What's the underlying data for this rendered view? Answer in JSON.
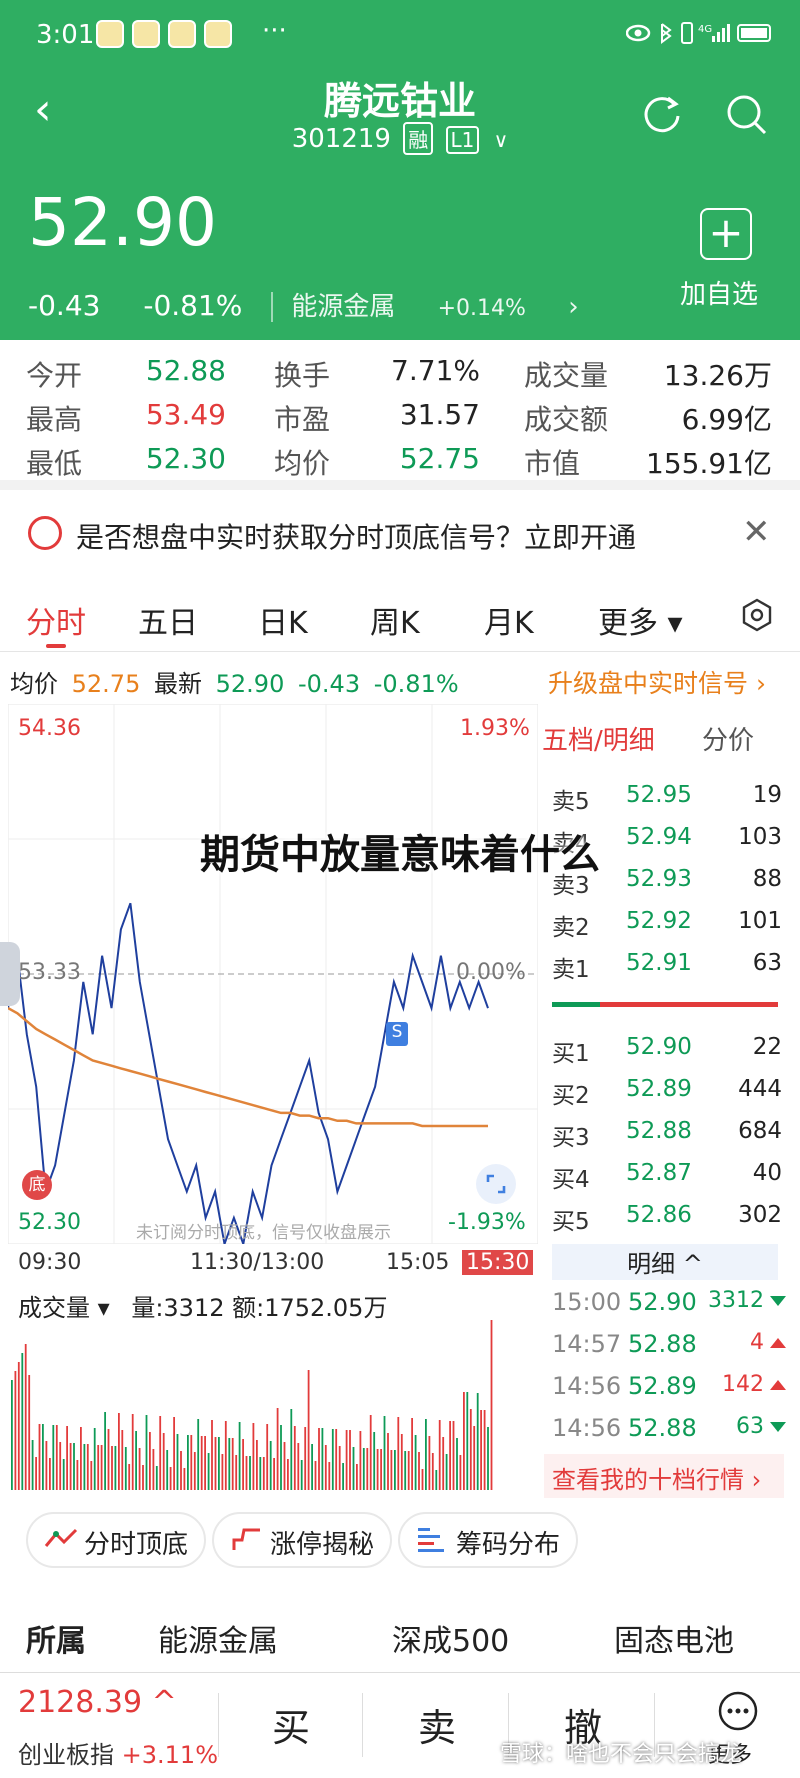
{
  "status": {
    "time": "3:01",
    "dots": "···",
    "right": "4G"
  },
  "header": {
    "name": "腾远钴业",
    "code": "301219",
    "tag1": "融",
    "tag2": "L1",
    "chevron": "∨",
    "back": "‹",
    "price": "52.90",
    "change": "-0.43",
    "change_pct": "-0.81%",
    "sector": "能源金属",
    "sector_pct": "+0.14%",
    "sector_arrow": "›",
    "add_icon": "+",
    "add_label": "加自选"
  },
  "stats": [
    {
      "label": "今开",
      "value": "52.88",
      "color": "green"
    },
    {
      "label": "换手",
      "value": "7.71%",
      "color": "black"
    },
    {
      "label": "成交量",
      "value": "13.26万",
      "color": "black"
    },
    {
      "label": "最高",
      "value": "53.49",
      "color": "red"
    },
    {
      "label": "市盈",
      "value": "31.57",
      "color": "black"
    },
    {
      "label": "成交额",
      "value": "6.99亿",
      "color": "black"
    },
    {
      "label": "最低",
      "value": "52.30",
      "color": "green"
    },
    {
      "label": "均价",
      "value": "52.75",
      "color": "green"
    },
    {
      "label": "市值",
      "value": "155.91亿",
      "color": "black"
    }
  ],
  "banner": {
    "text": "是否想盘中实时获取分时顶底信号？立即开通",
    "close": "✕"
  },
  "tabs": [
    "分时",
    "五日",
    "日K",
    "周K",
    "月K",
    "更多 ▾"
  ],
  "info": {
    "avg_label": "均价",
    "avg": "52.75",
    "last_label": "最新",
    "last": "52.90",
    "chg": "-0.43",
    "pct": "-0.81%",
    "upgrade": "升级盘中实时信号 ›"
  },
  "chart": {
    "high": "54.36",
    "high_pct": "1.93%",
    "mid": "53.33",
    "mid_pct": "0.00%",
    "low": "52.30",
    "low_pct": "-1.93%",
    "note": "未订阅分时顶底，信号仅收盘展示",
    "s_mark": "S",
    "bottom_mark": "底",
    "times": [
      "09:30",
      "11:30/13:00",
      "15:05",
      "15:30"
    ]
  },
  "chart_data": {
    "type": "line",
    "ylim": [
      52.3,
      54.36
    ],
    "series": [
      {
        "values": [
          53.2,
          53.4,
          53.1,
          52.9,
          52.5,
          52.6,
          52.8,
          53.0,
          53.3,
          53.1,
          53.4,
          53.2,
          53.5,
          53.6,
          53.3,
          53.1,
          52.9,
          52.7,
          52.6,
          52.5,
          52.6,
          52.4,
          52.5,
          52.3,
          52.4,
          52.3,
          52.5,
          52.4,
          52.6,
          52.7,
          52.8,
          52.9,
          53.0,
          52.8,
          52.7,
          52.5,
          52.6,
          52.7,
          52.8,
          52.9,
          53.1,
          53.3,
          53.2,
          53.4,
          53.3,
          53.2,
          53.4,
          53.2,
          53.3,
          53.2,
          53.3,
          53.2
        ]
      },
      {
        "values": [
          53.2,
          53.18,
          53.15,
          53.12,
          53.1,
          53.08,
          53.06,
          53.04,
          53.02,
          53.0,
          52.99,
          52.98,
          52.97,
          52.96,
          52.95,
          52.94,
          52.93,
          52.92,
          52.91,
          52.9,
          52.89,
          52.88,
          52.87,
          52.86,
          52.85,
          52.84,
          52.83,
          52.82,
          52.81,
          52.8,
          52.8,
          52.79,
          52.79,
          52.78,
          52.78,
          52.77,
          52.77,
          52.76,
          52.76,
          52.76,
          52.76,
          52.76,
          52.76,
          52.76,
          52.75,
          52.75,
          52.75,
          52.75,
          52.75,
          52.75,
          52.75,
          52.75
        ]
      }
    ]
  },
  "book": {
    "title": "五档/明细",
    "alt": "分价",
    "sell": [
      {
        "label": "卖5",
        "price": "52.95",
        "vol": "19"
      },
      {
        "label": "卖4",
        "price": "52.94",
        "vol": "103"
      },
      {
        "label": "卖3",
        "price": "52.93",
        "vol": "88"
      },
      {
        "label": "卖2",
        "price": "52.92",
        "vol": "101"
      },
      {
        "label": "卖1",
        "price": "52.91",
        "vol": "63"
      }
    ],
    "buy": [
      {
        "label": "买1",
        "price": "52.90",
        "vol": "22"
      },
      {
        "label": "买2",
        "price": "52.89",
        "vol": "444"
      },
      {
        "label": "买3",
        "price": "52.88",
        "vol": "684"
      },
      {
        "label": "买4",
        "price": "52.87",
        "vol": "40"
      },
      {
        "label": "买5",
        "price": "52.86",
        "vol": "302"
      }
    ],
    "detail_head": "明细 ^",
    "details": [
      {
        "time": "15:00",
        "price": "52.90",
        "vol": "3312",
        "dir": "down"
      },
      {
        "time": "14:57",
        "price": "52.88",
        "vol": "4",
        "dir": "up"
      },
      {
        "time": "14:56",
        "price": "52.89",
        "vol": "142",
        "dir": "up"
      },
      {
        "time": "14:56",
        "price": "52.88",
        "vol": "63",
        "dir": "down"
      }
    ],
    "ten_link": "查看我的十档行情 ›"
  },
  "volume": {
    "label": "成交量 ▾",
    "info": "量:3312 额:1752.05万"
  },
  "pills": [
    "分时顶底",
    "涨停揭秘",
    "筹码分布"
  ],
  "sector_row": [
    "所属",
    "能源金属",
    "深成500",
    "固态电池"
  ],
  "bottom": {
    "index_val": "2128.39 ^",
    "index_name": "创业板指",
    "index_pct": "+3.11%",
    "buy": "买",
    "sell": "卖",
    "cancel": "撤",
    "more": "更多"
  },
  "watermark": "雪球：啥也不会只会搞龙",
  "overlay_title": "期货中放量意味着什么",
  "colors": {
    "header": "#2fae62",
    "red": "#e23b3b",
    "green": "#0e9a56",
    "orange": "#e8801c"
  }
}
